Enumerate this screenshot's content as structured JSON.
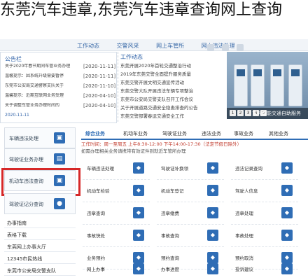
{
  "title": "东莞汽车违章,东莞汽车违章查询网上查询",
  "header": {
    "nav": [
      "工作动态",
      "交警风采",
      "网上车管所",
      "网上违法处理"
    ]
  },
  "notice": {
    "heading": "公告栏",
    "items": [
      {
        "text": "关于2020年春节期间车管业务办理",
        "date": "[2020-11-11]"
      },
      {
        "text": "温馨提示：因系统升级需要暂停",
        "date": "[2020-11-11]"
      },
      {
        "text": "东莞市公安局交通警察支队关于",
        "date": "[2020-11-10]"
      },
      {
        "text": "温馨提示：近期互联网业务受理",
        "date": "[2020-04-10]"
      },
      {
        "text": "关于调整车管业务办理时间的",
        "date": "[2020-04-10]"
      }
    ],
    "footer_date": "2020-11-11"
  },
  "news": {
    "title": "工作动态",
    "lines": [
      "东莞开展2020年首轮交通整治行动",
      "2019年东莞交警全面提升服务质量",
      "东莞交警开展文明交通宣传活动",
      "东莞交警大队开展违法车辆专项整治",
      "东莞市公安局交警支队召开工作会议",
      "关于开展道路交通安全隐患排查的公告",
      "东莞交警部署春运交通安全工作"
    ]
  },
  "photo": {
    "caption": "东莞智能交通自助服务",
    "dots": [
      "1",
      "2",
      "3",
      "4",
      "5"
    ]
  },
  "left_services": [
    {
      "label": "车辆违法处理",
      "icon": "car-icon"
    },
    {
      "label": "驾驶证业务办理",
      "icon": "id-card-icon"
    },
    {
      "label": "机动车违法查询",
      "icon": "car-icon"
    },
    {
      "label": "驾驶证记分查询",
      "icon": "user-icon"
    }
  ],
  "left_links": [
    "办事指南",
    "表格下载",
    "东莞网上办事大厅",
    "12345市民热线",
    "东莞市公安局交警支队"
  ],
  "tabs": [
    "综合业务",
    "机动车业务",
    "驾驶证业务",
    "违法业务",
    "事故业务",
    "其他业务"
  ],
  "hours": "工作时间：周一至周五 上午8:30-12:00 下午14:00-17:30（法定节假日除外）",
  "hours2": "如需办理相关业务请携带有效证件到就近车管所办理",
  "grid": [
    [
      "车辆违法处理",
      "驾驶证补换领",
      "违法记录查询"
    ],
    [
      "机动车检验",
      "机动车登记",
      "驾驶人信息"
    ],
    [
      "违章查询",
      "违章缴费",
      "违章处理"
    ],
    [
      "事故快处",
      "事故查询",
      "事故处理"
    ],
    [
      "业务预约",
      "预约查询",
      "预约取消"
    ],
    [
      "网上办事",
      "办事进度",
      "投诉建议"
    ]
  ]
}
